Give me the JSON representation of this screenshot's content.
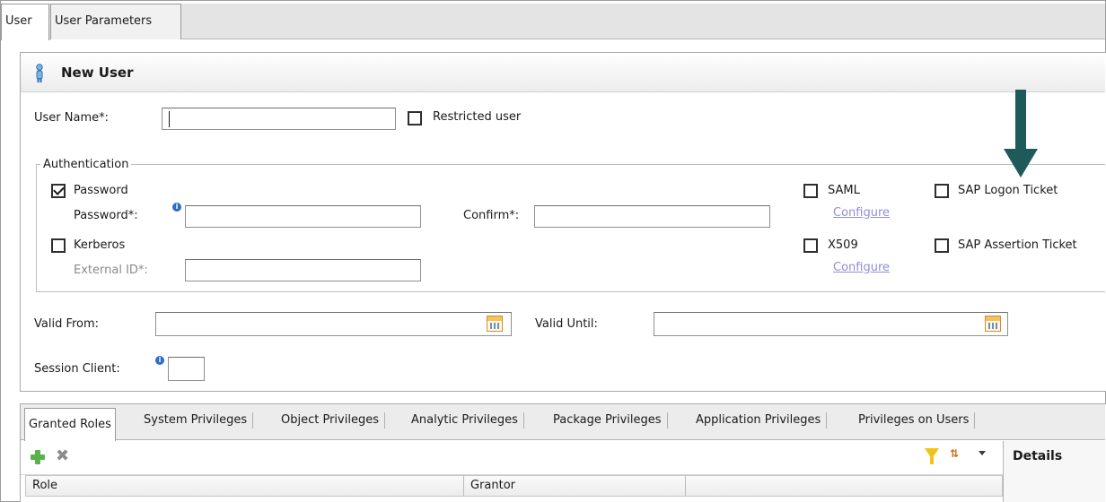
{
  "tabs": [
    {
      "label": "User",
      "active": true
    },
    {
      "label": "User Parameters",
      "active": false
    }
  ],
  "panel": {
    "title": "New User",
    "icon": "person-icon"
  },
  "user_name": {
    "label": "User Name*:",
    "value": ""
  },
  "restricted_user": {
    "label": "Restricted user",
    "checked": false
  },
  "authentication": {
    "legend": "Authentication",
    "password": {
      "label": "Password",
      "checked": true
    },
    "password_field": {
      "label": "Password*:",
      "value": ""
    },
    "confirm_field": {
      "label": "Confirm*:",
      "value": ""
    },
    "kerberos": {
      "label": "Kerberos",
      "checked": false
    },
    "external_id": {
      "label": "External ID*:",
      "value": ""
    },
    "saml": {
      "label": "SAML",
      "checked": false,
      "configure": "Configure"
    },
    "x509": {
      "label": "X509",
      "checked": false,
      "configure": "Configure"
    },
    "sap_logon_ticket": {
      "label": "SAP Logon Ticket",
      "checked": false
    },
    "sap_assertion_ticket": {
      "label": "SAP Assertion Ticket",
      "checked": false
    }
  },
  "valid_from": {
    "label": "Valid From:",
    "value": ""
  },
  "valid_until": {
    "label": "Valid Until:",
    "value": ""
  },
  "session_client": {
    "label": "Session Client:",
    "value": ""
  },
  "bottom_tabs": [
    "Granted Roles",
    "System Privileges",
    "Object Privileges",
    "Analytic Privileges",
    "Package Privileges",
    "Application Privileges",
    "Privileges on Users"
  ],
  "grid": {
    "columns": [
      "Role",
      "Grantor"
    ]
  },
  "details": {
    "title": "Details"
  },
  "colors": {
    "annotation_arrow": "#1f5a5a",
    "link": "#8f8fd6",
    "accent_add": "#59b34a"
  }
}
